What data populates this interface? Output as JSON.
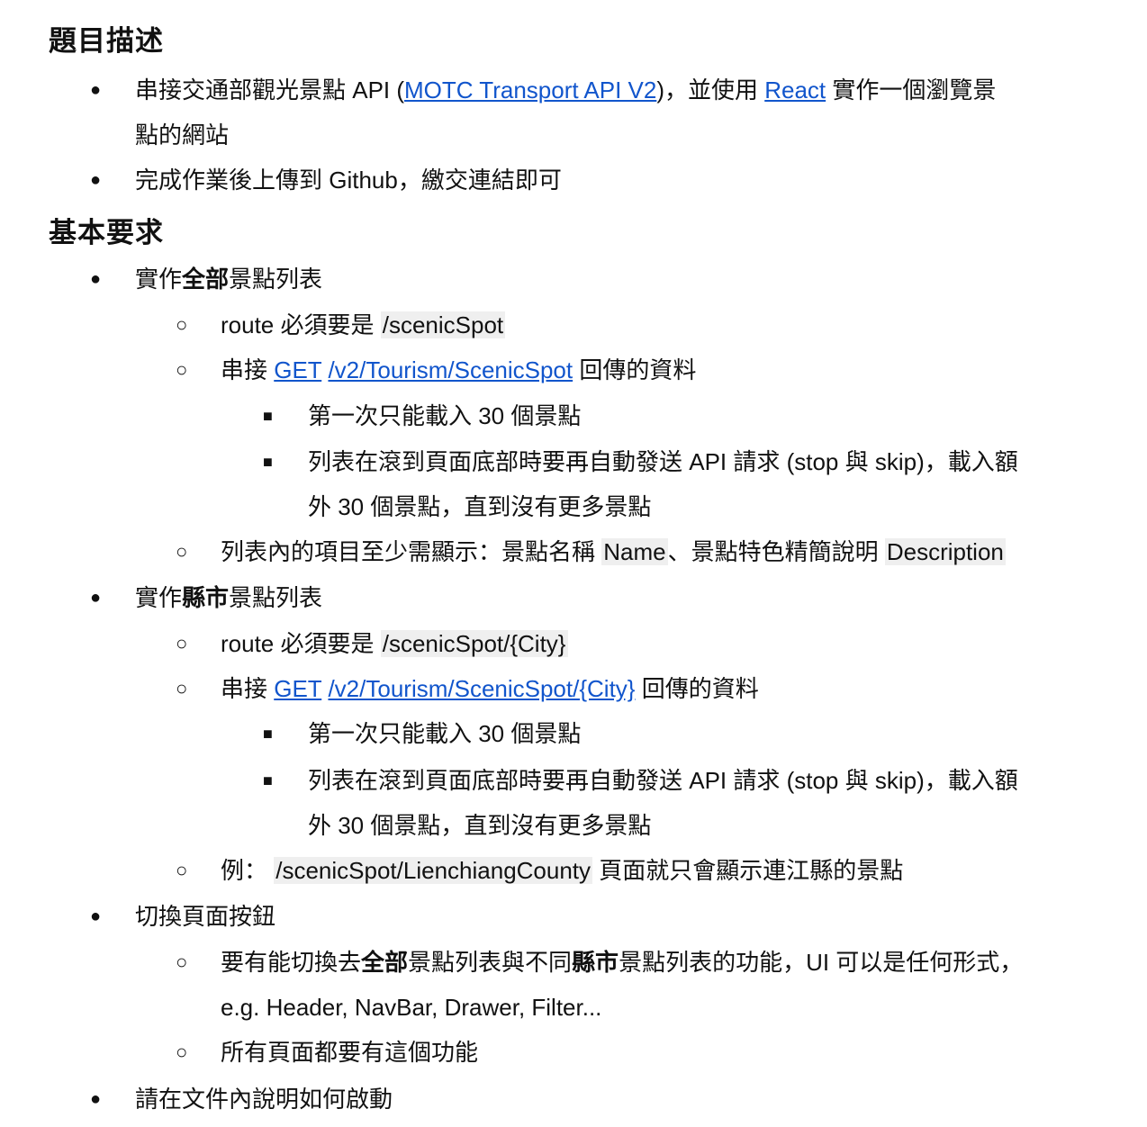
{
  "sec1": {
    "title": "題目描述",
    "i1": {
      "pre": "串接交通部觀光景點 API (",
      "link1": "MOTC Transport API V2",
      "mid": ")，並使用 ",
      "link2": "React",
      "post": " 實作一個瀏覽景",
      "cont": "點的網站"
    },
    "i2": "完成作業後上傳到 Github，繳交連結即可"
  },
  "sec2": {
    "title": "基本要求",
    "a": {
      "pre": "實作",
      "bold": "全部",
      "post": "景點列表",
      "route_label": "route 必須要是 ",
      "route_code": "/scenicSpot",
      "api_pre": "串接 ",
      "api_get": "GET",
      "api_path": "/v2/Tourism/ScenicSpot",
      "api_post": " 回傳的資料",
      "s1": "第一次只能載入 30 個景點",
      "s2a": "列表在滾到頁面底部時要再自動發送 API 請求 (stop 與 skip)，載入額",
      "s2b": "外 30 個景點，直到沒有更多景點",
      "list_pre": "列表內的項目至少需顯示：景點名稱 ",
      "list_name": "Name",
      "list_mid": "、景點特色精簡說明 ",
      "list_desc": "Description"
    },
    "b": {
      "pre": "實作",
      "bold": "縣市",
      "post": "景點列表",
      "route_label": "route 必須要是 ",
      "route_code": "/scenicSpot/{City}",
      "api_pre": "串接 ",
      "api_get": "GET",
      "api_path": "/v2/Tourism/ScenicSpot/{City}",
      "api_post": " 回傳的資料",
      "s1": "第一次只能載入 30 個景點",
      "s2a": "列表在滾到頁面底部時要再自動發送 API 請求 (stop 與 skip)，載入額",
      "s2b": "外 30 個景點，直到沒有更多景點",
      "ex_pre": "例：",
      "ex_code": "/scenicSpot/LienchiangCounty",
      "ex_post": " 頁面就只會顯示連江縣的景點"
    },
    "c": {
      "label": "切換頁面按鈕",
      "s1_pre": "要有能切換去",
      "s1_b1": "全部",
      "s1_mid": "景點列表與不同",
      "s1_b2": "縣市",
      "s1_post": "景點列表的功能，UI 可以是任何形式，",
      "s1_cont": "e.g. Header, NavBar, Drawer, Filter...",
      "s2": "所有頁面都要有這個功能"
    },
    "d": "請在文件內說明如何啟動"
  },
  "markers": {
    "bullet": "●",
    "circle": "○",
    "square": "■"
  }
}
